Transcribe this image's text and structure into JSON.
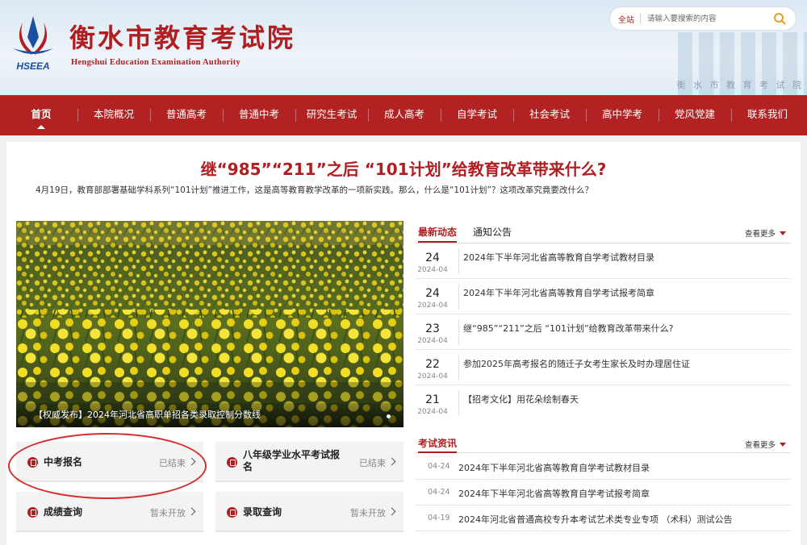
{
  "header": {
    "title": "衡水市教育考试院",
    "subtitle": "Hengshui Education Examination Authority",
    "logo_text": "HSEEA",
    "slogan": "衡 水 市 教 育 考 试 院",
    "search": {
      "scope": "全站",
      "placeholder": "请输入要搜索的内容"
    }
  },
  "nav": {
    "items": [
      {
        "label": "首页"
      },
      {
        "label": "本院概况"
      },
      {
        "label": "普通高考"
      },
      {
        "label": "普通中考"
      },
      {
        "label": "研究生考试"
      },
      {
        "label": "成人高考"
      },
      {
        "label": "自学考试"
      },
      {
        "label": "社会考试"
      },
      {
        "label": "高中学考"
      },
      {
        "label": "党风党建"
      },
      {
        "label": "联系我们"
      }
    ],
    "active": "首页"
  },
  "headline": {
    "title": "继“985”“211”之后 “101计划”给教育改革带来什么?",
    "lead": "4月19日，教育部部署基础学科系列“101计划”推进工作，这是高等教育教学改革的一项新实践。那么，什么是“101计划”？这项改革究竟要改什么？"
  },
  "banner": {
    "caption": "【权威发布】2024年河北省高职单招各类录取控制分数线"
  },
  "services": [
    {
      "label": "中考报名",
      "status": "已结束"
    },
    {
      "label": "八年级学业水平考试报名",
      "status": "已结束"
    },
    {
      "label": "成绩查询",
      "status": "暂未开放"
    },
    {
      "label": "录取查询",
      "status": "暂未开放"
    }
  ],
  "news": {
    "tabs": [
      "最新动态",
      "通知公告"
    ],
    "more": "查看更多",
    "items": [
      {
        "day": "24",
        "ym": "2024-04",
        "title": "2024年下半年河北省高等教育自学考试教材目录"
      },
      {
        "day": "24",
        "ym": "2024-04",
        "title": "2024年下半年河北省高等教育自学考试报考简章"
      },
      {
        "day": "23",
        "ym": "2024-04",
        "title": "继“985”“211”之后 “101计划”给教育改革带来什么?"
      },
      {
        "day": "22",
        "ym": "2024-04",
        "title": "参加2025年高考报名的随迁子女考生家长及时办理居住证"
      },
      {
        "day": "21",
        "ym": "2024-04",
        "title": "【招考文化】用花朵绘制春天"
      }
    ]
  },
  "exam_info": {
    "tab": "考试资讯",
    "more": "查看更多",
    "items": [
      {
        "date": "04-24",
        "title": "2024年下半年河北省高等教育自学考试教材目录"
      },
      {
        "date": "04-24",
        "title": "2024年下半年河北省高等教育自学考试报考简章"
      },
      {
        "date": "04-19",
        "title": "2024年河北省普通高校专升本考试艺术类专业专项 （术科）测试公告"
      }
    ]
  },
  "colors": {
    "brand_red": "#b01e22",
    "nav_red": "#b22222",
    "annotation_red": "#d62b2b"
  }
}
